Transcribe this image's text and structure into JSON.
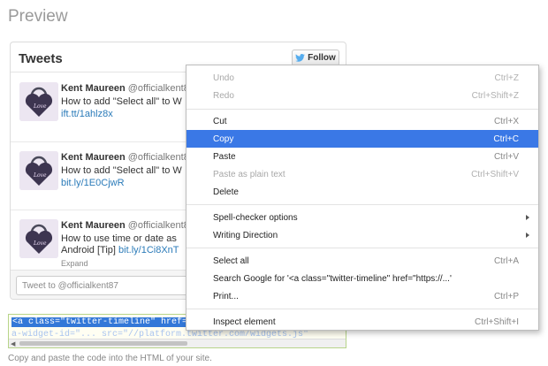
{
  "page": {
    "title": "Preview"
  },
  "widget": {
    "title": "Tweets",
    "follow_label": "Follow",
    "tweets": [
      {
        "name": "Kent Maureen",
        "handle": "@officialkent8",
        "text": "How to add \"Select all\" to W",
        "link": "ift.tt/1ahlz8x"
      },
      {
        "name": "Kent Maureen",
        "handle": "@officialkent8",
        "text": "How to add \"Select all\" to W",
        "link": "bit.ly/1E0CjwR"
      },
      {
        "name": "Kent Maureen",
        "handle": "@officialkent8",
        "text": "How to use time or date as",
        "text2_prefix": "Android [Tip]",
        "link": "bit.ly/1Ci8XnT",
        "expand": "Expand"
      }
    ],
    "tweet_box_placeholder": "Tweet to @officialkent87"
  },
  "code": {
    "line1": "<a class=\"twitter-timeline\" href=\"https://t",
    "line2": "                 a-widget-id=\"... src=\"//platform.twitter.com/widgets.js\""
  },
  "hint": "Copy and paste the code into the HTML of your site.",
  "context_menu": {
    "items": [
      {
        "label": "Undo",
        "shortcut": "Ctrl+Z",
        "disabled": true
      },
      {
        "label": "Redo",
        "shortcut": "Ctrl+Shift+Z",
        "disabled": true
      },
      {
        "label": "Cut",
        "shortcut": "Ctrl+X"
      },
      {
        "label": "Copy",
        "shortcut": "Ctrl+C",
        "selected": true
      },
      {
        "label": "Paste",
        "shortcut": "Ctrl+V"
      },
      {
        "label": "Paste as plain text",
        "shortcut": "Ctrl+Shift+V",
        "disabled": true
      },
      {
        "label": "Delete",
        "shortcut": ""
      },
      {
        "label": "Spell-checker options",
        "shortcut": ""
      },
      {
        "label": "Writing Direction",
        "shortcut": ""
      },
      {
        "label": "Select all",
        "shortcut": "Ctrl+A"
      },
      {
        "label": "Search Google for '<a class=\"twitter-timeline\" href=\"https://...'",
        "shortcut": ""
      },
      {
        "label": "Print...",
        "shortcut": "Ctrl+P"
      },
      {
        "label": "Inspect element",
        "shortcut": "Ctrl+Shift+I"
      }
    ]
  },
  "colors": {
    "accent": "#3a78e6",
    "link": "#2b7bb9",
    "twitter_blue": "#55acee"
  }
}
